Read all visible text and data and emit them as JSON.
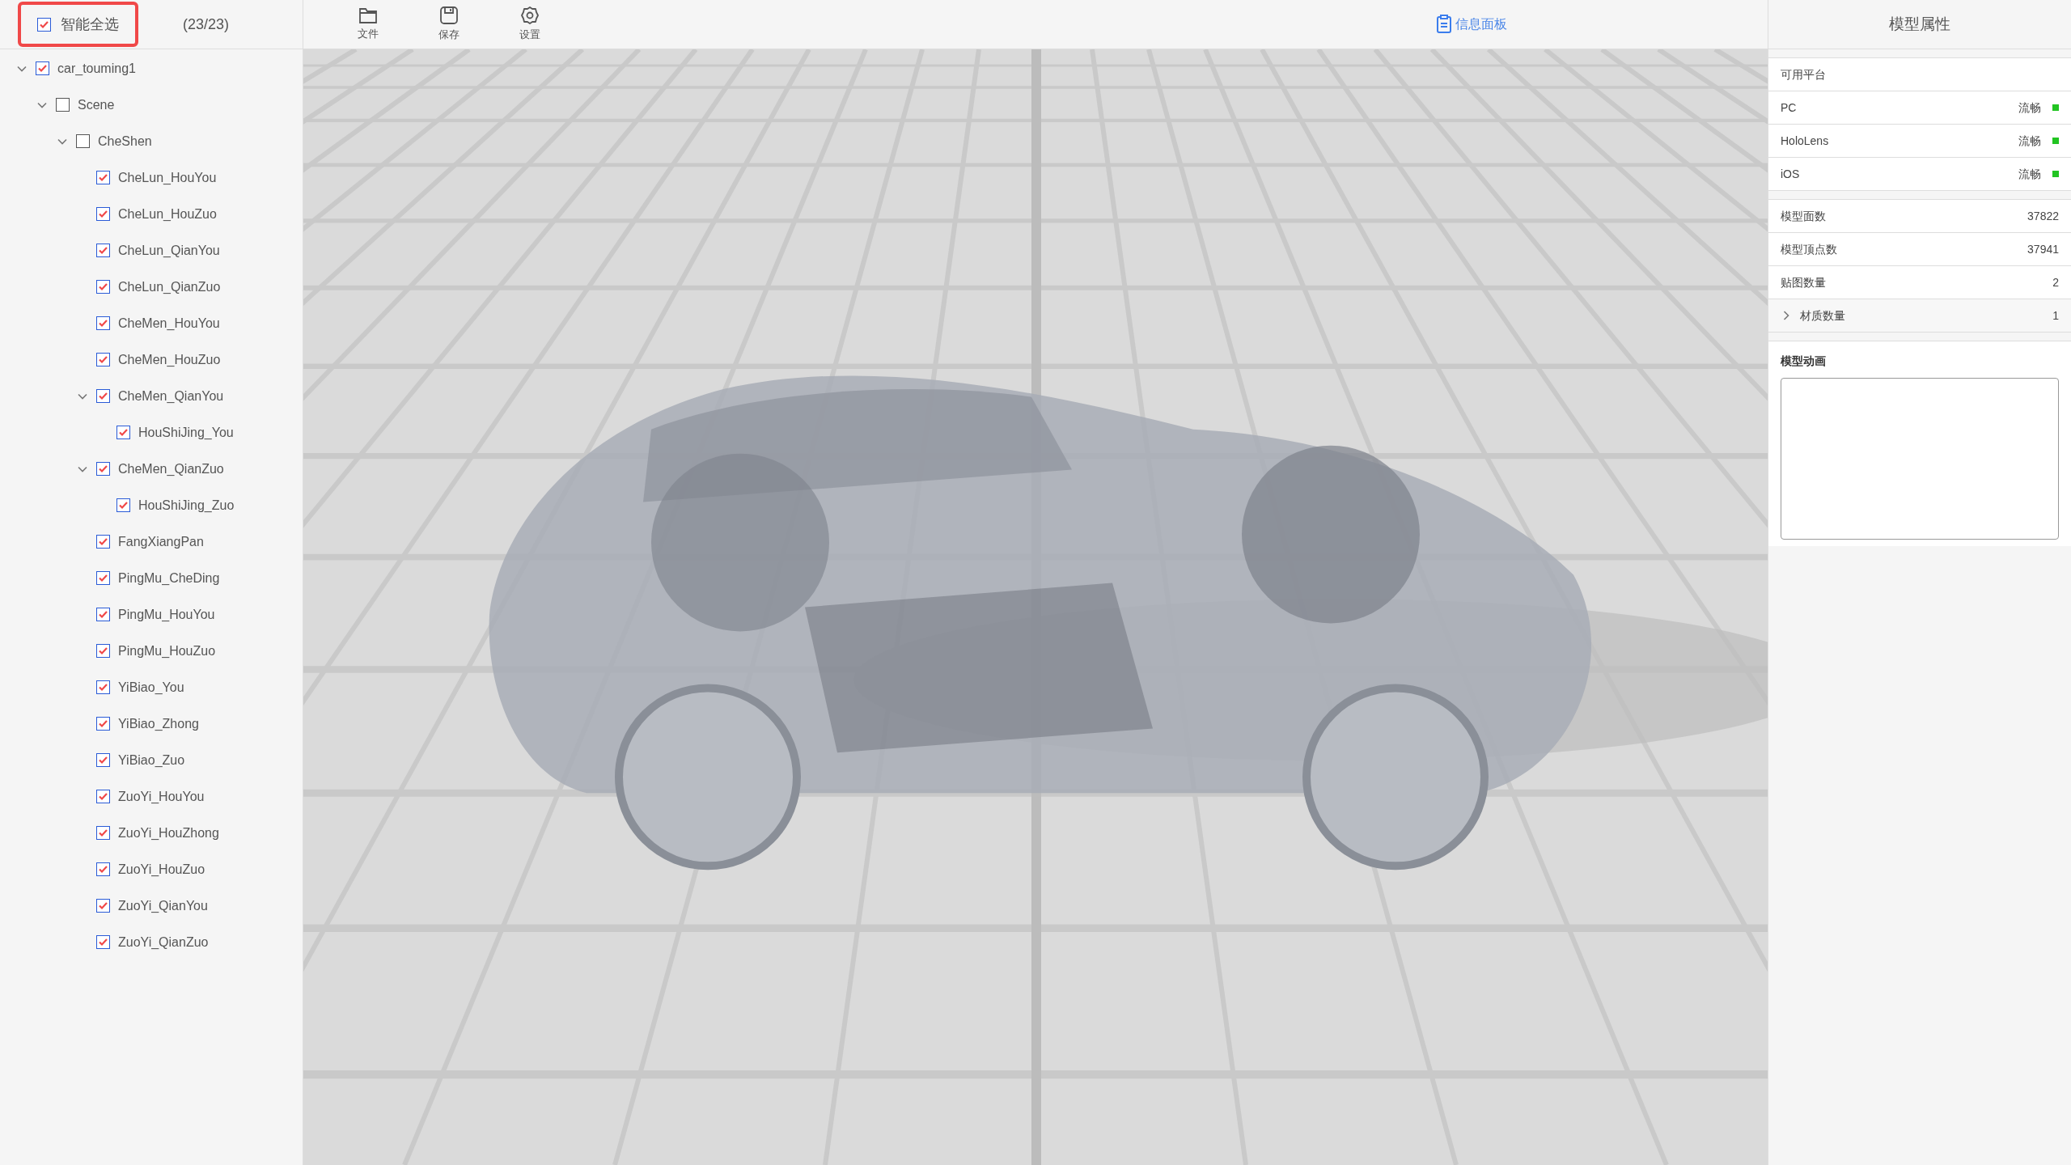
{
  "select_all": {
    "label": "智能全选",
    "checked": true,
    "count": "(23/23)"
  },
  "toolbar": [
    {
      "label": "文件",
      "kind": "folder"
    },
    {
      "label": "保存",
      "kind": "save"
    },
    {
      "label": "设置",
      "kind": "settings"
    }
  ],
  "info_button": {
    "label": "信息面板"
  },
  "tree": [
    {
      "label": "car_touming1",
      "checked": true,
      "expanded": true,
      "children": [
        {
          "label": "Scene",
          "checked": false,
          "expanded": true,
          "children": [
            {
              "label": "CheShen",
              "checked": false,
              "expanded": true,
              "children": [
                {
                  "label": "CheLun_HouYou",
                  "checked": true
                },
                {
                  "label": "CheLun_HouZuo",
                  "checked": true
                },
                {
                  "label": "CheLun_QianYou",
                  "checked": true
                },
                {
                  "label": "CheLun_QianZuo",
                  "checked": true
                },
                {
                  "label": "CheMen_HouYou",
                  "checked": true
                },
                {
                  "label": "CheMen_HouZuo",
                  "checked": true
                },
                {
                  "label": "CheMen_QianYou",
                  "checked": true,
                  "expanded": true,
                  "children": [
                    {
                      "label": "HouShiJing_You",
                      "checked": true
                    }
                  ]
                },
                {
                  "label": "CheMen_QianZuo",
                  "checked": true,
                  "expanded": true,
                  "children": [
                    {
                      "label": "HouShiJing_Zuo",
                      "checked": true
                    }
                  ]
                },
                {
                  "label": "FangXiangPan",
                  "checked": true
                },
                {
                  "label": "PingMu_CheDing",
                  "checked": true
                },
                {
                  "label": "PingMu_HouYou",
                  "checked": true
                },
                {
                  "label": "PingMu_HouZuo",
                  "checked": true
                },
                {
                  "label": "YiBiao_You",
                  "checked": true
                },
                {
                  "label": "YiBiao_Zhong",
                  "checked": true
                },
                {
                  "label": "YiBiao_Zuo",
                  "checked": true
                },
                {
                  "label": "ZuoYi_HouYou",
                  "checked": true
                },
                {
                  "label": "ZuoYi_HouZhong",
                  "checked": true
                },
                {
                  "label": "ZuoYi_HouZuo",
                  "checked": true
                },
                {
                  "label": "ZuoYi_QianYou",
                  "checked": true
                },
                {
                  "label": "ZuoYi_QianZuo",
                  "checked": true
                }
              ]
            }
          ]
        }
      ]
    }
  ],
  "properties": {
    "title": "模型属性",
    "platforms_header": "可用平台",
    "platforms": [
      {
        "name": "PC",
        "status": "流畅",
        "color": "#22c422"
      },
      {
        "name": "HoloLens",
        "status": "流畅",
        "color": "#22c422"
      },
      {
        "name": "iOS",
        "status": "流畅",
        "color": "#22c422"
      }
    ],
    "stats": [
      {
        "label": "模型面数",
        "value": "37822",
        "kind": "plain"
      },
      {
        "label": "模型顶点数",
        "value": "37941",
        "kind": "plain"
      },
      {
        "label": "贴图数量",
        "value": "2",
        "kind": "plain"
      },
      {
        "label": "材质数量",
        "value": "1",
        "kind": "expandable",
        "expanded": false
      }
    ],
    "animation": {
      "title": "模型动画"
    }
  }
}
